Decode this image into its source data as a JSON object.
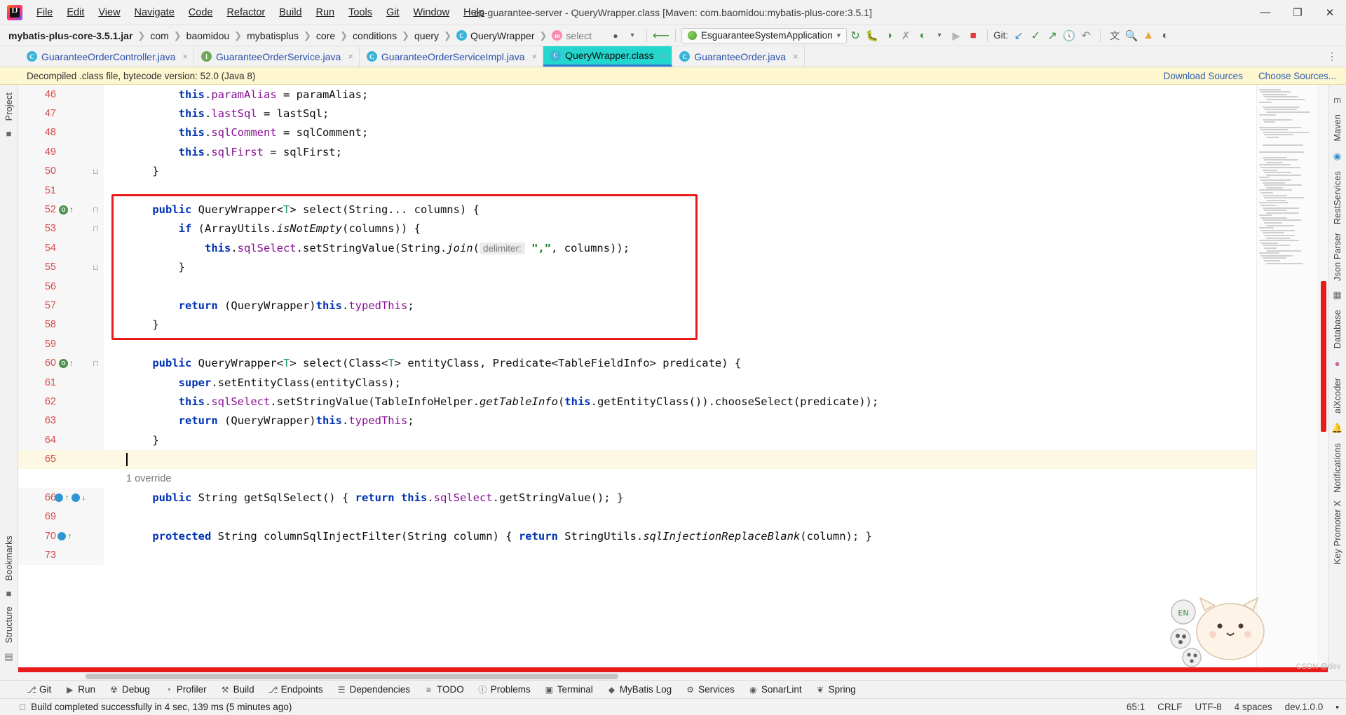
{
  "window": {
    "title": "es-guarantee-server - QueryWrapper.class [Maven: com.baomidou:mybatis-plus-core:3.5.1]",
    "logo_letters": "IJ",
    "minimize": "—",
    "maximize": "❐",
    "close": "✕"
  },
  "menu": [
    {
      "label": "File"
    },
    {
      "label": "Edit"
    },
    {
      "label": "View"
    },
    {
      "label": "Navigate"
    },
    {
      "label": "Code"
    },
    {
      "label": "Refactor"
    },
    {
      "label": "Build"
    },
    {
      "label": "Run"
    },
    {
      "label": "Tools"
    },
    {
      "label": "Git"
    },
    {
      "label": "Window"
    },
    {
      "label": "Help"
    }
  ],
  "breadcrumbs": [
    {
      "label": "mybatis-plus-core-3.5.1.jar",
      "kind": "module"
    },
    {
      "label": "com",
      "kind": "pkg"
    },
    {
      "label": "baomidou",
      "kind": "pkg"
    },
    {
      "label": "mybatisplus",
      "kind": "pkg"
    },
    {
      "label": "core",
      "kind": "pkg"
    },
    {
      "label": "conditions",
      "kind": "pkg"
    },
    {
      "label": "query",
      "kind": "pkg"
    },
    {
      "label": "QueryWrapper",
      "kind": "class",
      "icon_letter": "C"
    },
    {
      "label": "select",
      "kind": "method",
      "icon_letter": "m"
    }
  ],
  "toolbar": {
    "run_config": "EsguaranteeSystemApplication",
    "run_config_caret": "⌄",
    "git_label": "Git:",
    "icons": [
      {
        "name": "profile-icon",
        "glyph": "●"
      },
      {
        "name": "back-arrow-icon",
        "glyph": "↖"
      },
      {
        "name": "update-project-icon",
        "glyph": "↻"
      },
      {
        "name": "debug-icon",
        "glyph": "☢"
      },
      {
        "name": "coverage-icon",
        "glyph": "◑"
      },
      {
        "name": "profiler-icon",
        "glyph": "✇"
      },
      {
        "name": "more-run-icon",
        "glyph": "▶"
      },
      {
        "name": "run-dropdown-icon",
        "glyph": "▾"
      },
      {
        "name": "run-play-icon",
        "glyph": "▶"
      },
      {
        "name": "stop-icon",
        "glyph": "■"
      },
      {
        "name": "git-update-icon",
        "glyph": "↙"
      },
      {
        "name": "git-commit-icon",
        "glyph": "✓"
      },
      {
        "name": "git-push-icon",
        "glyph": "↗"
      },
      {
        "name": "git-history-icon",
        "glyph": "◴"
      },
      {
        "name": "git-rollback-icon",
        "glyph": "↶"
      },
      {
        "name": "translate-icon",
        "glyph": "文"
      },
      {
        "name": "search-everywhere-icon",
        "glyph": "⚲"
      },
      {
        "name": "notification-icon",
        "glyph": "↑"
      },
      {
        "name": "ai-assistant-icon",
        "glyph": "◐"
      }
    ]
  },
  "tabs": [
    {
      "label": "GuaranteeOrderController.java",
      "icon_letter": "C",
      "icon_kind": "class",
      "active": false
    },
    {
      "label": "GuaranteeOrderService.java",
      "icon_letter": "I",
      "icon_kind": "iface",
      "active": false
    },
    {
      "label": "GuaranteeOrderServiceImpl.java",
      "icon_letter": "C",
      "icon_kind": "class",
      "active": false
    },
    {
      "label": "QueryWrapper.class",
      "icon_letter": "C",
      "icon_kind": "class",
      "active": true
    },
    {
      "label": "GuaranteeOrder.java",
      "icon_letter": "C",
      "icon_kind": "class",
      "active": false
    }
  ],
  "tab_close_glyph": "×",
  "tabs_menu_glyph": "⋮",
  "notification": {
    "text": "Decompiled .class file, bytecode version: 52.0 (Java 8)",
    "link_download": "Download Sources",
    "link_choose": "Choose Sources..."
  },
  "left_strip": {
    "project_label": "Project",
    "bookmarks_label": "Bookmarks",
    "structure_label": "Structure"
  },
  "right_strip": {
    "items": [
      {
        "label": "Maven"
      },
      {
        "label": "RestServices"
      },
      {
        "label": "Json Parser"
      },
      {
        "label": "Database"
      },
      {
        "label": "aiXcoder"
      },
      {
        "label": "Notifications"
      },
      {
        "label": "Key Promoter X"
      }
    ]
  },
  "editor": {
    "first_line": 46,
    "caret_line": 65,
    "override_hint": "1 override",
    "lines": [
      {
        "n": 46,
        "indent": 8,
        "tokens": [
          {
            "t": "this",
            "c": "this"
          },
          {
            "t": ".",
            "c": "plain"
          },
          {
            "t": "paramAlias",
            "c": "fld"
          },
          {
            "t": " = paramAlias;",
            "c": "plain"
          }
        ]
      },
      {
        "n": 47,
        "indent": 8,
        "tokens": [
          {
            "t": "this",
            "c": "this"
          },
          {
            "t": ".",
            "c": "plain"
          },
          {
            "t": "lastSql",
            "c": "fld"
          },
          {
            "t": " = lastSql;",
            "c": "plain"
          }
        ]
      },
      {
        "n": 48,
        "indent": 8,
        "tokens": [
          {
            "t": "this",
            "c": "this"
          },
          {
            "t": ".",
            "c": "plain"
          },
          {
            "t": "sqlComment",
            "c": "fld"
          },
          {
            "t": " = sqlComment;",
            "c": "plain"
          }
        ]
      },
      {
        "n": 49,
        "indent": 8,
        "tokens": [
          {
            "t": "this",
            "c": "this"
          },
          {
            "t": ".",
            "c": "plain"
          },
          {
            "t": "sqlFirst",
            "c": "fld"
          },
          {
            "t": " = sqlFirst;",
            "c": "plain"
          }
        ]
      },
      {
        "n": 50,
        "indent": 4,
        "fold": true,
        "tokens": [
          {
            "t": "}",
            "c": "plain"
          }
        ]
      },
      {
        "n": 51,
        "indent": 0,
        "tokens": []
      },
      {
        "n": 52,
        "indent": 4,
        "gutter": "run-override",
        "fold": true,
        "tokens": [
          {
            "t": "public",
            "c": "kw"
          },
          {
            "t": " QueryWrapper<",
            "c": "typ"
          },
          {
            "t": "T",
            "c": "tparam"
          },
          {
            "t": "> select(String... columns) {",
            "c": "typ"
          }
        ]
      },
      {
        "n": 53,
        "indent": 8,
        "fold": true,
        "tokens": [
          {
            "t": "if",
            "c": "kw"
          },
          {
            "t": " (ArrayUtils.",
            "c": "plain"
          },
          {
            "t": "isNotEmpty",
            "c": "imth"
          },
          {
            "t": "(columns)) {",
            "c": "plain"
          }
        ]
      },
      {
        "n": 54,
        "indent": 12,
        "tokens": [
          {
            "t": "this",
            "c": "this"
          },
          {
            "t": ".",
            "c": "plain"
          },
          {
            "t": "sqlSelect",
            "c": "fld"
          },
          {
            "t": ".setStringValue(String.",
            "c": "plain"
          },
          {
            "t": "join",
            "c": "imth"
          },
          {
            "t": "(",
            "c": "plain"
          },
          {
            "t": "HINT:delimiter:",
            "c": "hint"
          },
          {
            "t": " ",
            "c": "plain"
          },
          {
            "t": "\",\"",
            "c": "str"
          },
          {
            "t": ", columns));",
            "c": "plain"
          }
        ]
      },
      {
        "n": 55,
        "indent": 8,
        "fold": true,
        "tokens": [
          {
            "t": "}",
            "c": "plain"
          }
        ]
      },
      {
        "n": 56,
        "indent": 0,
        "tokens": []
      },
      {
        "n": 57,
        "indent": 8,
        "tokens": [
          {
            "t": "return",
            "c": "kw"
          },
          {
            "t": " (QueryWrapper)",
            "c": "plain"
          },
          {
            "t": "this",
            "c": "this"
          },
          {
            "t": ".",
            "c": "plain"
          },
          {
            "t": "typedThis",
            "c": "fld"
          },
          {
            "t": ";",
            "c": "plain"
          }
        ]
      },
      {
        "n": 58,
        "indent": 4,
        "tokens": [
          {
            "t": "}",
            "c": "plain"
          }
        ]
      },
      {
        "n": 59,
        "indent": 0,
        "tokens": []
      },
      {
        "n": 60,
        "indent": 4,
        "gutter": "run-override",
        "fold": true,
        "tokens": [
          {
            "t": "public",
            "c": "kw"
          },
          {
            "t": " QueryWrapper<",
            "c": "typ"
          },
          {
            "t": "T",
            "c": "tparam"
          },
          {
            "t": "> select(Class<",
            "c": "typ"
          },
          {
            "t": "T",
            "c": "tparam"
          },
          {
            "t": "> entityClass, Predicate<TableFieldInfo> predicate) {",
            "c": "typ"
          }
        ]
      },
      {
        "n": 61,
        "indent": 8,
        "tokens": [
          {
            "t": "super",
            "c": "kw"
          },
          {
            "t": ".setEntityClass(entityClass);",
            "c": "plain"
          }
        ]
      },
      {
        "n": 62,
        "indent": 8,
        "tokens": [
          {
            "t": "this",
            "c": "this"
          },
          {
            "t": ".",
            "c": "plain"
          },
          {
            "t": "sqlSelect",
            "c": "fld"
          },
          {
            "t": ".setStringValue(TableInfoHelper.",
            "c": "plain"
          },
          {
            "t": "getTableInfo",
            "c": "imth"
          },
          {
            "t": "(",
            "c": "plain"
          },
          {
            "t": "this",
            "c": "this"
          },
          {
            "t": ".getEntityClass()).chooseSelect(predicate));",
            "c": "plain"
          }
        ]
      },
      {
        "n": 63,
        "indent": 8,
        "tokens": [
          {
            "t": "return",
            "c": "kw"
          },
          {
            "t": " (QueryWrapper)",
            "c": "plain"
          },
          {
            "t": "this",
            "c": "this"
          },
          {
            "t": ".",
            "c": "plain"
          },
          {
            "t": "typedThis",
            "c": "fld"
          },
          {
            "t": ";",
            "c": "plain"
          }
        ]
      },
      {
        "n": 64,
        "indent": 4,
        "tokens": [
          {
            "t": "}",
            "c": "plain"
          }
        ]
      },
      {
        "n": 65,
        "indent": 0,
        "current": true,
        "caret": true,
        "tokens": []
      },
      {
        "n": null,
        "hintline": "1 override",
        "indent": 0,
        "tokens": []
      },
      {
        "n": 66,
        "indent": 4,
        "gutter": "bp-override",
        "tokens": [
          {
            "t": "public",
            "c": "kw"
          },
          {
            "t": " String getSqlSelect() { ",
            "c": "typ"
          },
          {
            "t": "return",
            "c": "kw"
          },
          {
            "t": " ",
            "c": "plain"
          },
          {
            "t": "this",
            "c": "this"
          },
          {
            "t": ".",
            "c": "plain"
          },
          {
            "t": "sqlSelect",
            "c": "fld"
          },
          {
            "t": ".getStringValue(); }",
            "c": "plain"
          }
        ]
      },
      {
        "n": 69,
        "indent": 0,
        "tokens": []
      },
      {
        "n": 70,
        "indent": 4,
        "gutter": "bp-arrow",
        "tokens": [
          {
            "t": "protected",
            "c": "kw"
          },
          {
            "t": " String columnSqlInjectFilter(String column) { ",
            "c": "typ"
          },
          {
            "t": "return",
            "c": "kw"
          },
          {
            "t": " StringUtils.",
            "c": "plain"
          },
          {
            "t": "sqlInjectionReplaceBlank",
            "c": "imth"
          },
          {
            "t": "(column); }",
            "c": "plain"
          }
        ]
      },
      {
        "n": 73,
        "indent": 0,
        "tokens": []
      }
    ],
    "annotation_rect": {
      "color": "#e81b1b",
      "label": "red-highlight-box"
    }
  },
  "bottom_tools": [
    {
      "label": "Git",
      "icon": "⎇"
    },
    {
      "label": "Run",
      "icon": "▶"
    },
    {
      "label": "Debug",
      "icon": "☢"
    },
    {
      "label": "Profiler",
      "icon": "◔"
    },
    {
      "label": "Build",
      "icon": "⚒"
    },
    {
      "label": "Endpoints",
      "icon": "⎇"
    },
    {
      "label": "Dependencies",
      "icon": "☰"
    },
    {
      "label": "TODO",
      "icon": "≡"
    },
    {
      "label": "Problems",
      "icon": "ⓘ"
    },
    {
      "label": "Terminal",
      "icon": "▣"
    },
    {
      "label": "MyBatis Log",
      "icon": "◆"
    },
    {
      "label": "Services",
      "icon": "⚙"
    },
    {
      "label": "SonarLint",
      "icon": "◉"
    },
    {
      "label": "Spring",
      "icon": "❦"
    }
  ],
  "status": {
    "message": "Build completed successfully in 4 sec, 139 ms (5 minutes ago)",
    "message_icon": "□",
    "caret_position": "65:1",
    "line_separator": "CRLF",
    "encoding": "UTF-8",
    "indent": "4 spaces",
    "branch": "dev.1.0.0",
    "lock_icon": "▪"
  },
  "colors": {
    "accent_tab": "#24d6cd",
    "annotation_red": "#e81b1b",
    "keyword_blue": "#0033b3",
    "field_purple": "#871094",
    "string_green": "#067d17",
    "line_number_red": "#d94a4a",
    "notification_yellow": "#fdf6cf",
    "current_line": "#fdf8e3"
  }
}
